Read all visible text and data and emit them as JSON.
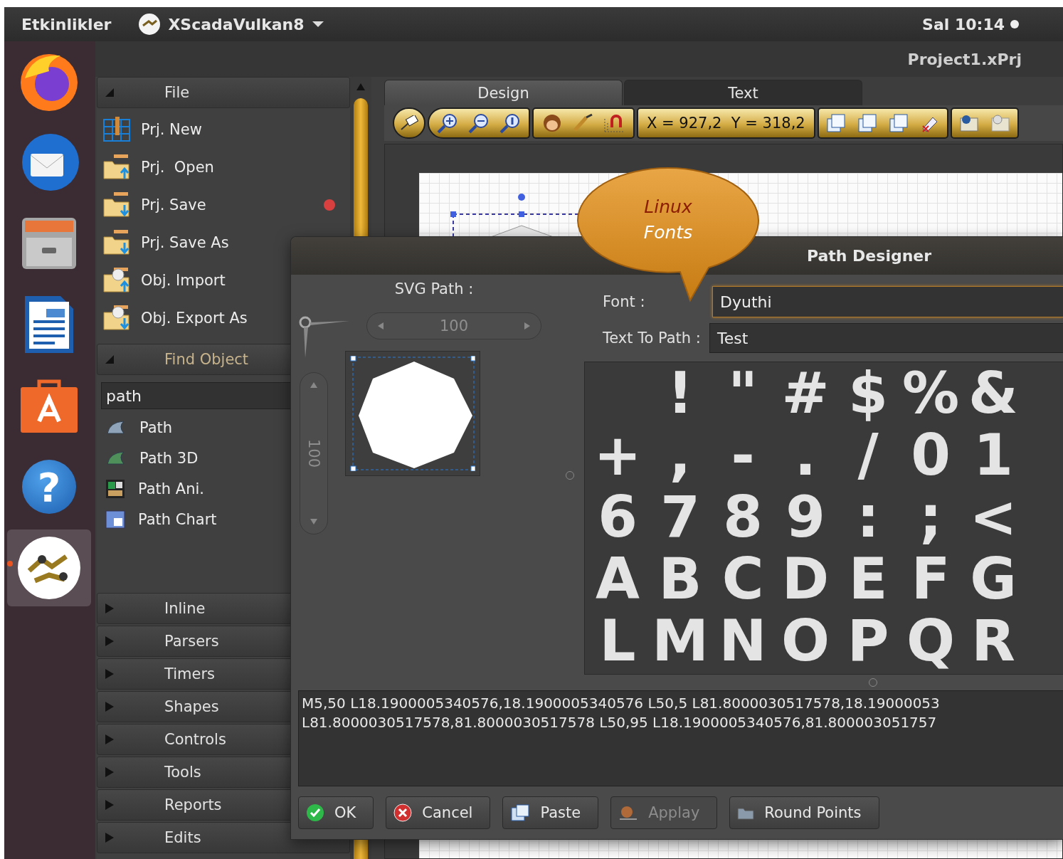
{
  "top_bar": {
    "activities": "Etkinlikler",
    "app_name": "XScadaVulkan8",
    "clock": "Sal 10:14"
  },
  "dock": [
    {
      "kind": "browser",
      "selected": false
    },
    {
      "kind": "mail",
      "selected": false
    },
    {
      "kind": "files",
      "selected": false
    },
    {
      "kind": "writer",
      "selected": false
    },
    {
      "kind": "store",
      "selected": false
    },
    {
      "kind": "help",
      "glyph": "?",
      "selected": false
    },
    {
      "kind": "app",
      "selected": true
    }
  ],
  "window": {
    "title": "Project1.xPrj"
  },
  "sidebar": {
    "file_section": {
      "title": "File",
      "expanded": true,
      "items": [
        {
          "label": "Prj. New",
          "kind": "grid",
          "unsaved": false
        },
        {
          "label": "Prj.  Open",
          "kind": "folderup",
          "unsaved": false
        },
        {
          "label": "Prj. Save",
          "kind": "folderdown",
          "unsaved": true
        },
        {
          "label": "Prj. Save As",
          "kind": "folderdown",
          "unsaved": false
        },
        {
          "label": "Obj. Import",
          "kind": "gaugeup",
          "unsaved": false
        },
        {
          "label": "Obj. Export As",
          "kind": "gaugedown",
          "unsaved": false
        }
      ]
    },
    "find_section": {
      "title": "Find Object",
      "expanded": true,
      "search": {
        "value": "path"
      },
      "results": [
        {
          "label": "Path",
          "kind": "path"
        },
        {
          "label": "Path 3D",
          "kind": "path3d"
        },
        {
          "label": "Path Ani.",
          "kind": "animation"
        },
        {
          "label": "Path Chart",
          "kind": "chart"
        }
      ]
    },
    "collapsed_sections": [
      {
        "title": "Inline",
        "expanded": false
      },
      {
        "title": "Parsers",
        "expanded": false
      },
      {
        "title": "Timers",
        "expanded": false
      },
      {
        "title": "Shapes",
        "expanded": false
      },
      {
        "title": "Controls",
        "expanded": false
      },
      {
        "title": "Tools",
        "expanded": false
      },
      {
        "title": "Reports",
        "expanded": false
      },
      {
        "title": "Edits",
        "expanded": false
      }
    ]
  },
  "tabs": [
    {
      "label": "Design",
      "selected": true
    },
    {
      "label": "Text",
      "selected": false
    }
  ],
  "toolbar": {
    "coordinates": "X = 927,2  Y = 318,2"
  },
  "dialog": {
    "title": "Path Designer",
    "svg_path_label": "SVG Path :",
    "width_value": "100",
    "height_value": "100",
    "font_label": "Font :",
    "font_value": "Dyuthi",
    "text_label": "Text To Path :",
    "text_value": "Test",
    "glyph_rows": [
      [
        "!",
        "\"",
        "#",
        "$",
        "%",
        "&"
      ],
      [
        "+",
        ",",
        "-",
        ".",
        "/",
        "0",
        "1"
      ],
      [
        "6",
        "7",
        "8",
        "9",
        ":",
        ";",
        "<"
      ],
      [
        "A",
        "B",
        "C",
        "D",
        "E",
        "F",
        "G"
      ],
      [
        "L",
        "M",
        "N",
        "O",
        "P",
        "Q",
        "R"
      ]
    ],
    "path_lines": [
      "M5,50 L18.1900005340576,18.1900005340576 L50,5 L81.8000030517578,18.19000053",
      "L81.8000030517578,81.8000030517578 L50,95 L18.1900005340576,81.800003051757"
    ],
    "buttons": [
      {
        "label": "OK",
        "kind": "check",
        "disabled": false
      },
      {
        "label": "Cancel",
        "kind": "cancel",
        "disabled": false
      },
      {
        "label": "Paste",
        "kind": "paste",
        "disabled": false
      },
      {
        "label": "Applay",
        "kind": "apply",
        "disabled": true
      },
      {
        "label": "Round Points",
        "kind": "folder",
        "disabled": false
      }
    ]
  },
  "callout": {
    "lines": [
      "Linux",
      "Fonts"
    ]
  }
}
